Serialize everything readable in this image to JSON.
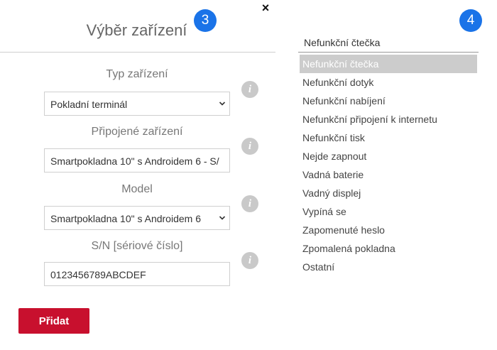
{
  "dialog": {
    "title": "Výběr zařízení",
    "close_symbol": "×",
    "badge": "3"
  },
  "form": {
    "device_type": {
      "label": "Typ zařízení",
      "value": "Pokladní terminál"
    },
    "connected_device": {
      "label": "Připojené zařízení",
      "value": "Smartpokladna 10\" s Androidem 6 - S/"
    },
    "model": {
      "label": "Model",
      "value": "Smartpokladna 10\" s Androidem 6"
    },
    "serial": {
      "label": "S/N [sériové číslo]",
      "value": "0123456789ABCDEF"
    },
    "info_glyph": "i",
    "add_button": "Přidat"
  },
  "dropdown": {
    "badge": "4",
    "selected": "Nefunkční čtečka",
    "items": [
      "Nefunkční čtečka",
      "Nefunkční dotyk",
      "Nefunkční nabíjení",
      "Nefunkční připojení k internetu",
      "Nefunkční tisk",
      "Nejde zapnout",
      "Vadná baterie",
      "Vadný displej",
      "Vypíná se",
      "Zapomenuté heslo",
      "Zpomalená pokladna",
      "Ostatní"
    ],
    "highlighted_index": 0
  },
  "colors": {
    "badge": "#1a73e8",
    "primary_button": "#c8102e",
    "highlight": "#cccccc",
    "info_icon": "#c9c9c9"
  },
  "icons": {
    "close": "close-icon",
    "info": "info-icon",
    "select_arrow": "chevron-down-icon"
  }
}
